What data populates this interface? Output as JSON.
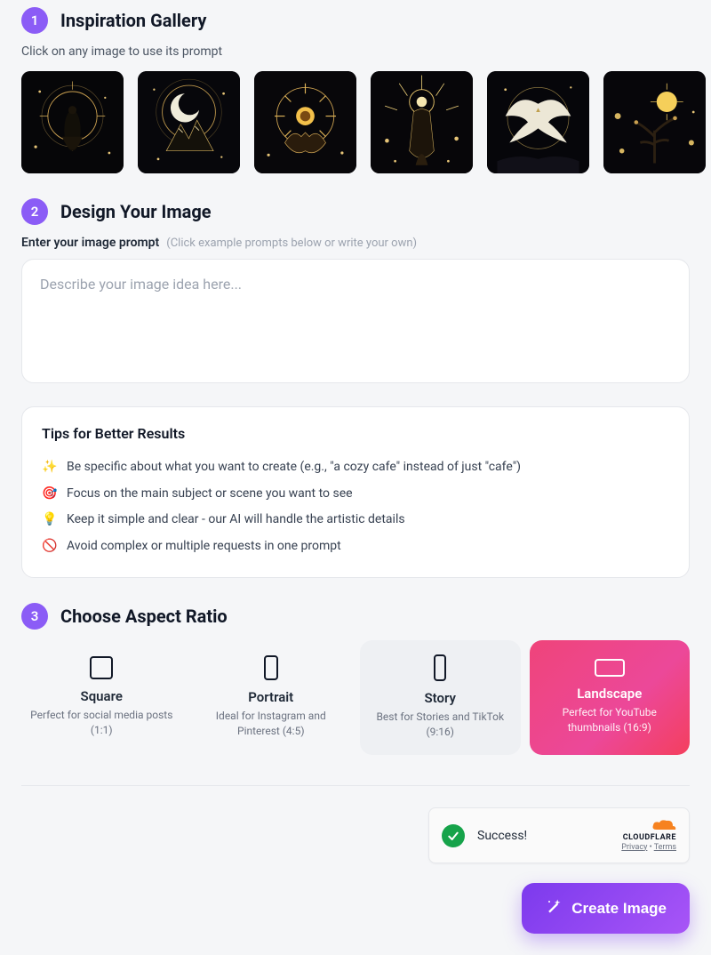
{
  "steps": {
    "s1": {
      "num": "1",
      "title": "Inspiration Gallery",
      "sub": "Click on any image to use its prompt"
    },
    "s2": {
      "num": "2",
      "title": "Design Your Image"
    },
    "s3": {
      "num": "3",
      "title": "Choose Aspect Ratio"
    }
  },
  "gallery": {
    "items": [
      {
        "name": "figure-halo"
      },
      {
        "name": "moon-mountain"
      },
      {
        "name": "hands-sun"
      },
      {
        "name": "goddess-radiant"
      },
      {
        "name": "dove-wings"
      },
      {
        "name": "tree-cosmos"
      }
    ]
  },
  "prompt": {
    "label": "Enter your image prompt",
    "hint": "(Click example prompts below or write your own)",
    "placeholder": "Describe your image idea here..."
  },
  "tips": {
    "title": "Tips for Better Results",
    "items": [
      {
        "emoji": "✨",
        "text": "Be specific about what you want to create (e.g., \"a cozy cafe\" instead of just \"cafe\")"
      },
      {
        "emoji": "🎯",
        "text": "Focus on the main subject or scene you want to see"
      },
      {
        "emoji": "💡",
        "text": "Keep it simple and clear - our AI will handle the artistic details"
      },
      {
        "emoji": "🚫",
        "text": "Avoid complex or multiple requests in one prompt"
      }
    ]
  },
  "ratios": {
    "r0": {
      "name": "Square",
      "desc": "Perfect for social media posts (1:1)"
    },
    "r1": {
      "name": "Portrait",
      "desc": "Ideal for Instagram and Pinterest (4:5)"
    },
    "r2": {
      "name": "Story",
      "desc": "Best for Stories and TikTok (9:16)"
    },
    "r3": {
      "name": "Landscape",
      "desc": "Perfect for YouTube thumbnails (16:9)"
    }
  },
  "captcha": {
    "status": "Success!",
    "brand": "CLOUDFLARE",
    "privacy": "Privacy",
    "terms": "Terms",
    "dot": " • "
  },
  "create_label": "Create Image"
}
